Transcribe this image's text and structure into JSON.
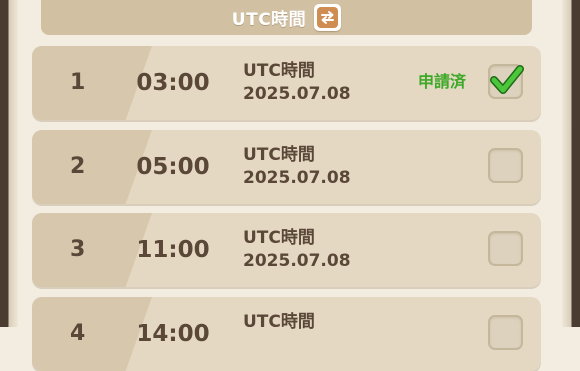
{
  "header": {
    "title": "UTC時間",
    "swap_icon": "swap-arrows-icon",
    "swap_color": "#cf8d52"
  },
  "rows": [
    {
      "index": "1",
      "time": "03:00",
      "timezone": "UTC時間",
      "date": "2025.07.08",
      "status": "申請済",
      "checked": true
    },
    {
      "index": "2",
      "time": "05:00",
      "timezone": "UTC時間",
      "date": "2025.07.08",
      "status": "",
      "checked": false
    },
    {
      "index": "3",
      "time": "11:00",
      "timezone": "UTC時間",
      "date": "2025.07.08",
      "status": "",
      "checked": false
    },
    {
      "index": "4",
      "time": "14:00",
      "timezone": "UTC時間",
      "date": "",
      "status": "",
      "checked": false
    }
  ],
  "colors": {
    "row_bg": "#e4d8c3",
    "index_bg": "#d7c8ad",
    "text": "#5a4738",
    "status_green": "#3ea928",
    "check_green": "#4cc63a"
  }
}
